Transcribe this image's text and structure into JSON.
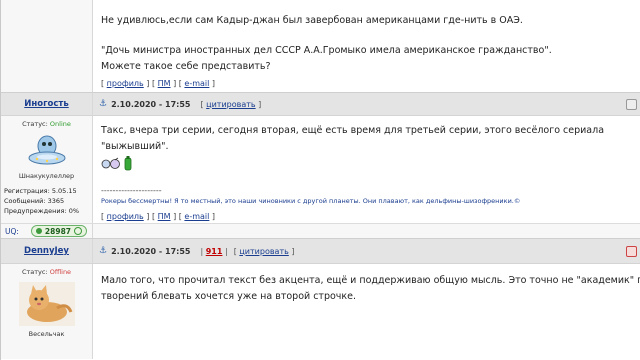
{
  "post1": {
    "line1": "Не удивлюсь,если сам Кадыр-джан был завербован американцами где-нить в ОАЭ.",
    "line2": "\"Дочь министра иностранных дел СССР А.А.Громыко имела американское гражданство\".",
    "line3": "Можете такое себе представить?",
    "links": {
      "profile": "профиль",
      "pm": "ПМ",
      "email": "e-mail"
    }
  },
  "post2": {
    "username": "Иногость",
    "date": "2.10.2020 - 17:55",
    "quote_label": "цитировать",
    "status_label": "Статус:",
    "status_value": "Online",
    "rank": "Шнакукулеллер",
    "stats": {
      "registration": "Регистрация: 5.05.15",
      "messages": "Сообщений: 3365",
      "warnings": "Предупреждения: 0%"
    },
    "text": "Такс, вчера три серии, сегодня вторая, ещё есть время для третьей серии, этого весёлого сериала \"выжывший\".",
    "signature": "Рокеры бессмертны! Я то местный, это наши чиновники с другой планеты. Они плавают, как дельфины-шизофреники.©",
    "signature_divider": "---------------------",
    "links": {
      "profile": "профиль",
      "pm": "ПМ",
      "email": "e-mail"
    },
    "uq_label": "UQ:",
    "uq_value": "28987",
    "colors": {
      "online": "#2e9c2e"
    }
  },
  "post3": {
    "username": "DennyJey",
    "date": "2.10.2020 - 17:55",
    "rep_value": "911",
    "quote_label": "цитировать",
    "status_label": "Статус:",
    "status_value": "Offline",
    "rank": "Весельчак",
    "text_line1": "Мало того, что прочитал текст без акцента, ещё и поддерживаю общую мысль. Это точно не \"академик\" писал, с е",
    "text_line2": "творений блевать хочется уже на второй строчке.",
    "colors": {
      "offline": "#d04040"
    }
  },
  "icons": [
    "anchor-icon",
    "ufo-avatar",
    "cat-avatar",
    "smiley-icons",
    "report-icon"
  ]
}
